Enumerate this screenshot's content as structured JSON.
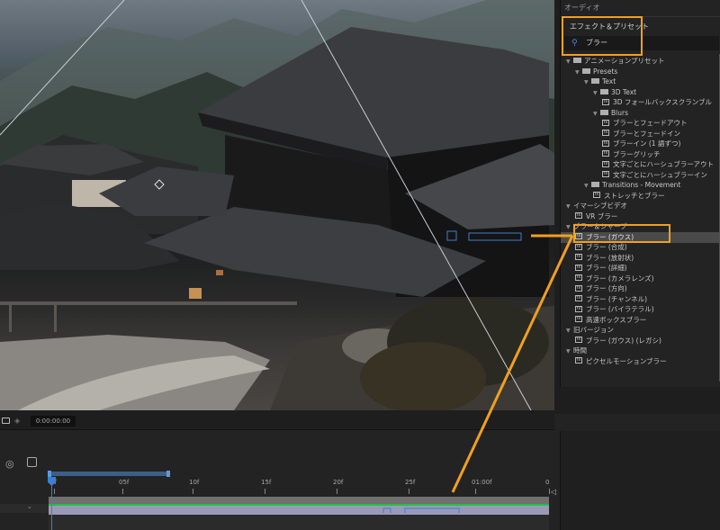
{
  "panel": {
    "audio_label": "オーディオ",
    "title": "エフェクト＆プリセット",
    "search_value": "ブラー",
    "tree": [
      {
        "label": "アニメーションプリセット",
        "indent": 0,
        "kind": "folder-open"
      },
      {
        "label": "Presets",
        "indent": 1,
        "kind": "folder-open"
      },
      {
        "label": "Text",
        "indent": 2,
        "kind": "folder-open"
      },
      {
        "label": "3D Text",
        "indent": 3,
        "kind": "folder-open"
      },
      {
        "label": "3D フォールバックスクランブル",
        "indent": 4,
        "kind": "fx"
      },
      {
        "label": "Blurs",
        "indent": 3,
        "kind": "folder-open"
      },
      {
        "label": "ブラーとフェードアウト",
        "indent": 4,
        "kind": "fx"
      },
      {
        "label": "ブラーとフェードイン",
        "indent": 4,
        "kind": "fx"
      },
      {
        "label": "ブラーイン (1 語ずつ)",
        "indent": 4,
        "kind": "fx"
      },
      {
        "label": "ブラーグリッチ",
        "indent": 4,
        "kind": "fx"
      },
      {
        "label": "文字ごとにハーシュブラーアウト",
        "indent": 4,
        "kind": "fx"
      },
      {
        "label": "文字ごとにハーシュブラーイン",
        "indent": 4,
        "kind": "fx"
      },
      {
        "label": "Transitions - Movement",
        "indent": 2,
        "kind": "folder-open"
      },
      {
        "label": "ストレッチとブラー",
        "indent": 3,
        "kind": "fx"
      },
      {
        "label": "イマーシブビデオ",
        "indent": 0,
        "kind": "category"
      },
      {
        "label": "VR ブラー",
        "indent": 1,
        "kind": "fx"
      },
      {
        "label": "ブラー＆シャープ",
        "indent": 0,
        "kind": "category"
      },
      {
        "label": "ブラー (ガウス)",
        "indent": 1,
        "kind": "fx",
        "selected": true
      },
      {
        "label": "ブラー (合成)",
        "indent": 1,
        "kind": "fx"
      },
      {
        "label": "ブラー (放射状)",
        "indent": 1,
        "kind": "fx"
      },
      {
        "label": "ブラー (詳細)",
        "indent": 1,
        "kind": "fx"
      },
      {
        "label": "ブラー (カメラレンズ)",
        "indent": 1,
        "kind": "fx"
      },
      {
        "label": "ブラー (方向)",
        "indent": 1,
        "kind": "fx"
      },
      {
        "label": "ブラー (チャンネル)",
        "indent": 1,
        "kind": "fx"
      },
      {
        "label": "ブラー (バイラテラル)",
        "indent": 1,
        "kind": "fx"
      },
      {
        "label": "高速ボックスブラー",
        "indent": 1,
        "kind": "fx"
      },
      {
        "label": "旧バージョン",
        "indent": 0,
        "kind": "category"
      },
      {
        "label": "ブラー (ガウス) (レガシ)",
        "indent": 1,
        "kind": "fx"
      },
      {
        "label": "時間",
        "indent": 0,
        "kind": "category"
      },
      {
        "label": "ピクセルモーションブラー",
        "indent": 1,
        "kind": "fx"
      }
    ]
  },
  "timeline": {
    "timecode": "0:00:00:00",
    "ruler": [
      "0f",
      "05f",
      "10f",
      "15f",
      "20f",
      "25f",
      "01:00f",
      "0"
    ]
  },
  "colors": {
    "highlight": "#f0a020",
    "accent_blue": "#3c7fd1",
    "layer_green": "#22c040"
  }
}
